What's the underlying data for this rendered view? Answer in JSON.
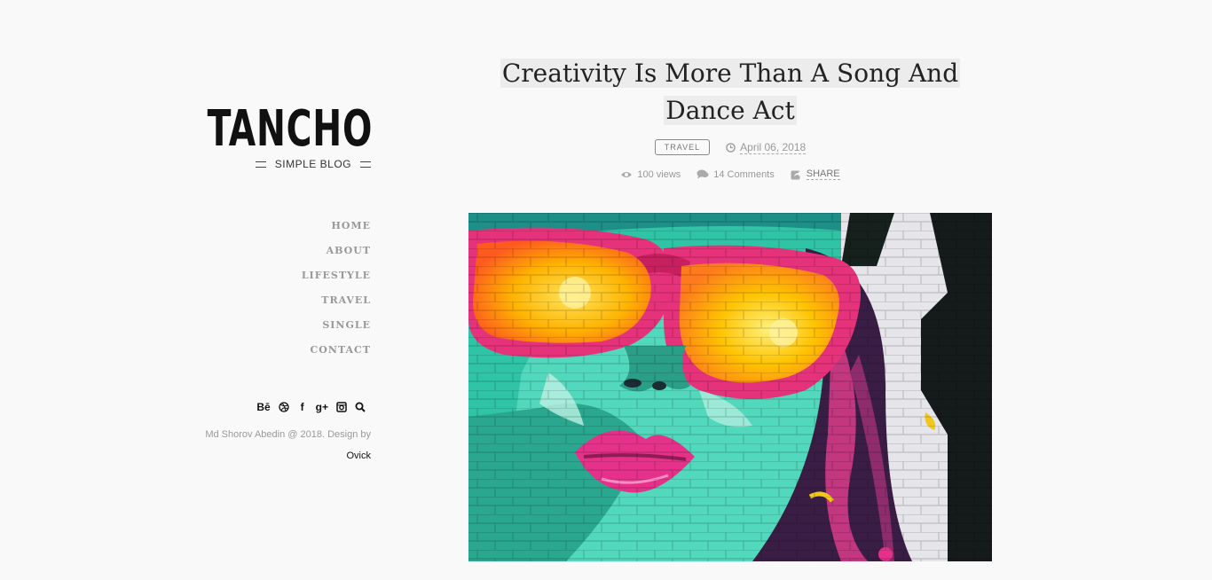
{
  "sidebar": {
    "logo": "TANCHO",
    "tagline": "SIMPLE BLOG",
    "nav": [
      "HOME",
      "ABOUT",
      "LIFESTYLE",
      "TRAVEL",
      "SINGLE",
      "CONTACT"
    ],
    "social": {
      "behance": "Bē",
      "facebook": "f",
      "google_plus": "g+"
    },
    "credit": "Md Shorov Abedin @ 2018. Design by",
    "credit_author": "Ovick"
  },
  "post": {
    "title": "Creativity Is More Than A Song And Dance Act",
    "category": "TRAVEL",
    "date": "April 06, 2018",
    "views": "100 views",
    "comments": "14 Comments",
    "share": "SHARE"
  },
  "icons": [
    "behance-icon",
    "dribbble-icon",
    "facebook-icon",
    "google-plus-icon",
    "instagram-icon",
    "search-icon",
    "clock-icon",
    "eye-icon",
    "comment-icon",
    "share-icon"
  ],
  "colors": {
    "background": "#f9f9f9",
    "muted": "#999999",
    "title_highlight": "#ececec"
  }
}
